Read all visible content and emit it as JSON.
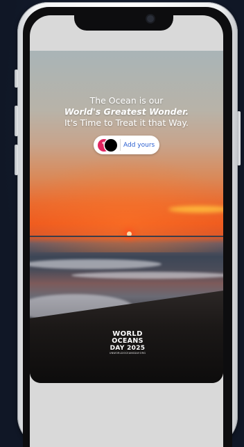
{
  "story": {
    "headline_line1": "The Ocean is our",
    "headline_line2": "World's Greatest Wonder.",
    "headline_line3": "It's Time to Treat it that Way."
  },
  "add_yours_sticker": {
    "label": "Add yours"
  },
  "logo": {
    "word1": "WORLD",
    "word2": "OCEANS",
    "word3": "DAY 2025",
    "url": "UNWORLDOCEANSDAY.ORG"
  },
  "colors": {
    "sticker_label": "#2b5fd0",
    "avatar_accent": "#e0245e",
    "background": "#121a2b"
  }
}
